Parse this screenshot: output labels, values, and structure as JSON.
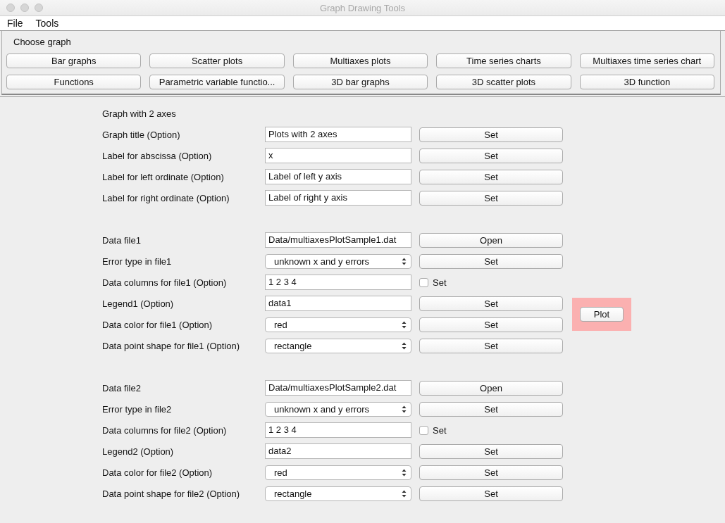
{
  "window": {
    "title": "Graph Drawing Tools"
  },
  "menu": [
    "File",
    "Tools"
  ],
  "chooser": {
    "title": "Choose graph",
    "buttons": [
      "Bar graphs",
      "Scatter plots",
      "Multiaxes plots",
      "Time series charts",
      "Multiaxes time series chart",
      "Functions",
      "Parametric variable functio...",
      "3D bar graphs",
      "3D scatter plots",
      "3D function"
    ]
  },
  "form": {
    "heading": "Graph with 2 axes",
    "sections": [
      {
        "rows": [
          {
            "label": "Graph title (Option)",
            "kind": "text",
            "value": "Plots with 2 axes",
            "action": {
              "kind": "button",
              "label": "Set"
            }
          },
          {
            "label": "Label for abscissa (Option)",
            "kind": "text",
            "value": "x",
            "action": {
              "kind": "button",
              "label": "Set"
            }
          },
          {
            "label": "Label for left ordinate (Option)",
            "kind": "text",
            "value": "Label of left y axis",
            "action": {
              "kind": "button",
              "label": "Set"
            }
          },
          {
            "label": "Label for right ordinate (Option)",
            "kind": "text",
            "value": "Label of right y axis",
            "action": {
              "kind": "button",
              "label": "Set"
            }
          }
        ]
      },
      {
        "rows": [
          {
            "label": "Data file1",
            "kind": "text",
            "value": "Data/multiaxesPlotSample1.dat",
            "action": {
              "kind": "button",
              "label": "Open"
            }
          },
          {
            "label": "Error type in file1",
            "kind": "select",
            "value": "unknown x and y errors",
            "action": {
              "kind": "button",
              "label": "Set"
            }
          },
          {
            "label": "Data columns for file1 (Option)",
            "kind": "text",
            "value": "1 2 3 4",
            "action": {
              "kind": "checkbox",
              "label": "Set",
              "checked": false
            }
          },
          {
            "label": "Legend1 (Option)",
            "kind": "text",
            "value": "data1",
            "action": {
              "kind": "button",
              "label": "Set"
            }
          },
          {
            "label": "Data color for file1 (Option)",
            "kind": "select",
            "value": "red",
            "action": {
              "kind": "button",
              "label": "Set"
            }
          },
          {
            "label": "Data point shape for file1 (Option)",
            "kind": "select",
            "value": "rectangle",
            "action": {
              "kind": "button",
              "label": "Set"
            }
          }
        ]
      },
      {
        "rows": [
          {
            "label": "Data file2",
            "kind": "text",
            "value": "Data/multiaxesPlotSample2.dat",
            "action": {
              "kind": "button",
              "label": "Open"
            }
          },
          {
            "label": "Error type in file2",
            "kind": "select",
            "value": "unknown x and y errors",
            "action": {
              "kind": "button",
              "label": "Set"
            }
          },
          {
            "label": "Data columns for file2 (Option)",
            "kind": "text",
            "value": "1 2 3 4",
            "action": {
              "kind": "checkbox",
              "label": "Set",
              "checked": false
            }
          },
          {
            "label": "Legend2 (Option)",
            "kind": "text",
            "value": "data2",
            "action": {
              "kind": "button",
              "label": "Set"
            }
          },
          {
            "label": "Data color for file2 (Option)",
            "kind": "select",
            "value": "red",
            "action": {
              "kind": "button",
              "label": "Set"
            }
          },
          {
            "label": "Data point shape for file2 (Option)",
            "kind": "select",
            "value": "rectangle",
            "action": {
              "kind": "button",
              "label": "Set"
            }
          }
        ]
      }
    ],
    "plot_button": "Plot"
  }
}
